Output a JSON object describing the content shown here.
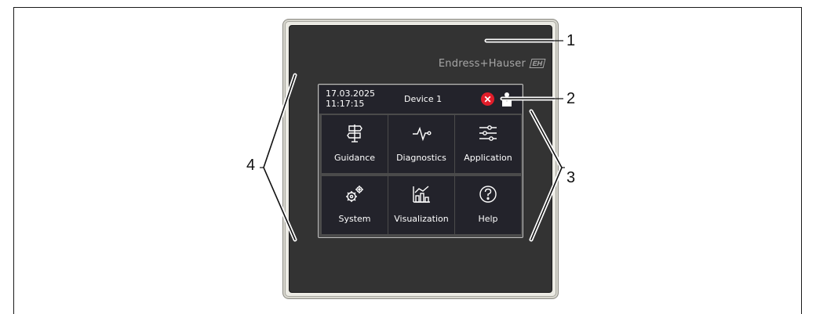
{
  "brand": {
    "name": "Endress+Hauser",
    "logo": "EH"
  },
  "header": {
    "date": "17.03.2025",
    "time": "11:17:15",
    "device": "Device 1"
  },
  "status_icons": [
    "error-icon",
    "user-icon"
  ],
  "tiles": [
    {
      "label": "Guidance",
      "icon": "signpost-icon"
    },
    {
      "label": "Diagnostics",
      "icon": "pulse-icon"
    },
    {
      "label": "Application",
      "icon": "sliders-icon"
    },
    {
      "label": "System",
      "icon": "gears-icon"
    },
    {
      "label": "Visualization",
      "icon": "chart-icon"
    },
    {
      "label": "Help",
      "icon": "help-icon"
    }
  ],
  "callouts": {
    "c1": "1",
    "c2": "2",
    "c3": "3",
    "c4": "4"
  },
  "colors": {
    "tile": "#23232b",
    "device_face": "#333333",
    "error": "#e21d2a"
  }
}
